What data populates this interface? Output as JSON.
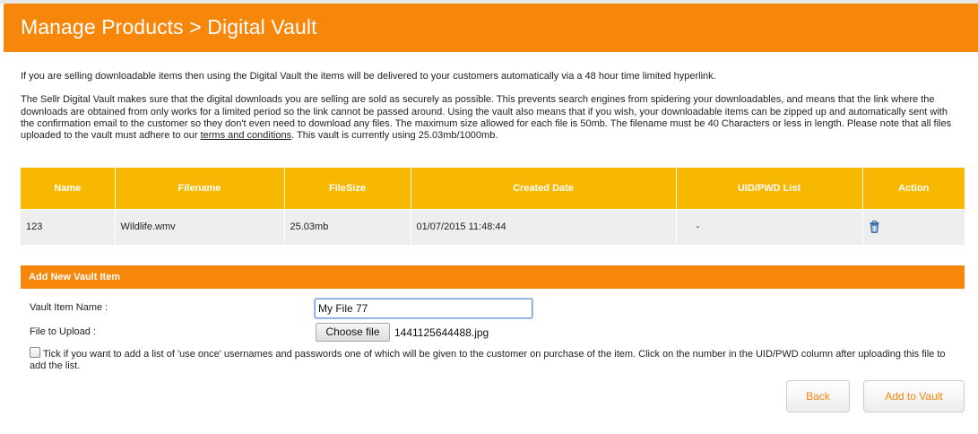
{
  "header": {
    "title": "Manage Products > Digital Vault"
  },
  "intro": {
    "p1": "If you are selling downloadable items then using the Digital Vault the items will be delivered to your customers automatically via a 48 hour time limited hyperlink.",
    "p2_before": "The Sellr Digital Vault makes sure that the digital downloads you are selling are sold as securely as possible. This prevents search engines from spidering your downloadables, and means that the link where the downloads are obtained from only works for a limited period so the link cannot be passed around. Using the vault also means that if you wish, your downloadable items can be zipped up and automatically sent with the confirmation email to the customer so they don't even need to download any files. The maximum size allowed for each file is 50mb. The filename must be 40 Characters or less in length. Please note that all files uploaded to the vault must adhere to our ",
    "terms_link": "terms and conditions",
    "p2_after": ". This vault is currently using 25.03mb/1000mb."
  },
  "table": {
    "headers": [
      "Name",
      "Filename",
      "FileSize",
      "Created Date",
      "UID/PWD List",
      "Action"
    ],
    "rows": [
      {
        "name": "123",
        "filename": "Wildlife.wmv",
        "filesize": "25.03mb",
        "created": "01/07/2015 11:48:44",
        "uid": "-",
        "action_icon": "trash-icon"
      }
    ]
  },
  "add_form": {
    "section_title": "Add New Vault Item",
    "name_label": "Vault Item Name :",
    "name_value": "My File 77",
    "file_label": "File to Upload :",
    "choose_file_label": "Choose file",
    "selected_file": "1441125644488.jpg",
    "tick_text": "Tick if you want to add a list of 'use once' usernames and passwords one of which will be given to the customer on purchase of the item. Click on the number in the UID/PWD column after uploading this file to add the list.",
    "tick_checked": false
  },
  "buttons": {
    "back": "Back",
    "add": "Add to Vault"
  },
  "colors": {
    "orange": "#f7870a",
    "header_yellow": "#f8b700",
    "row_gray": "#eeeeee",
    "icon_blue": "#3a6ea8"
  }
}
